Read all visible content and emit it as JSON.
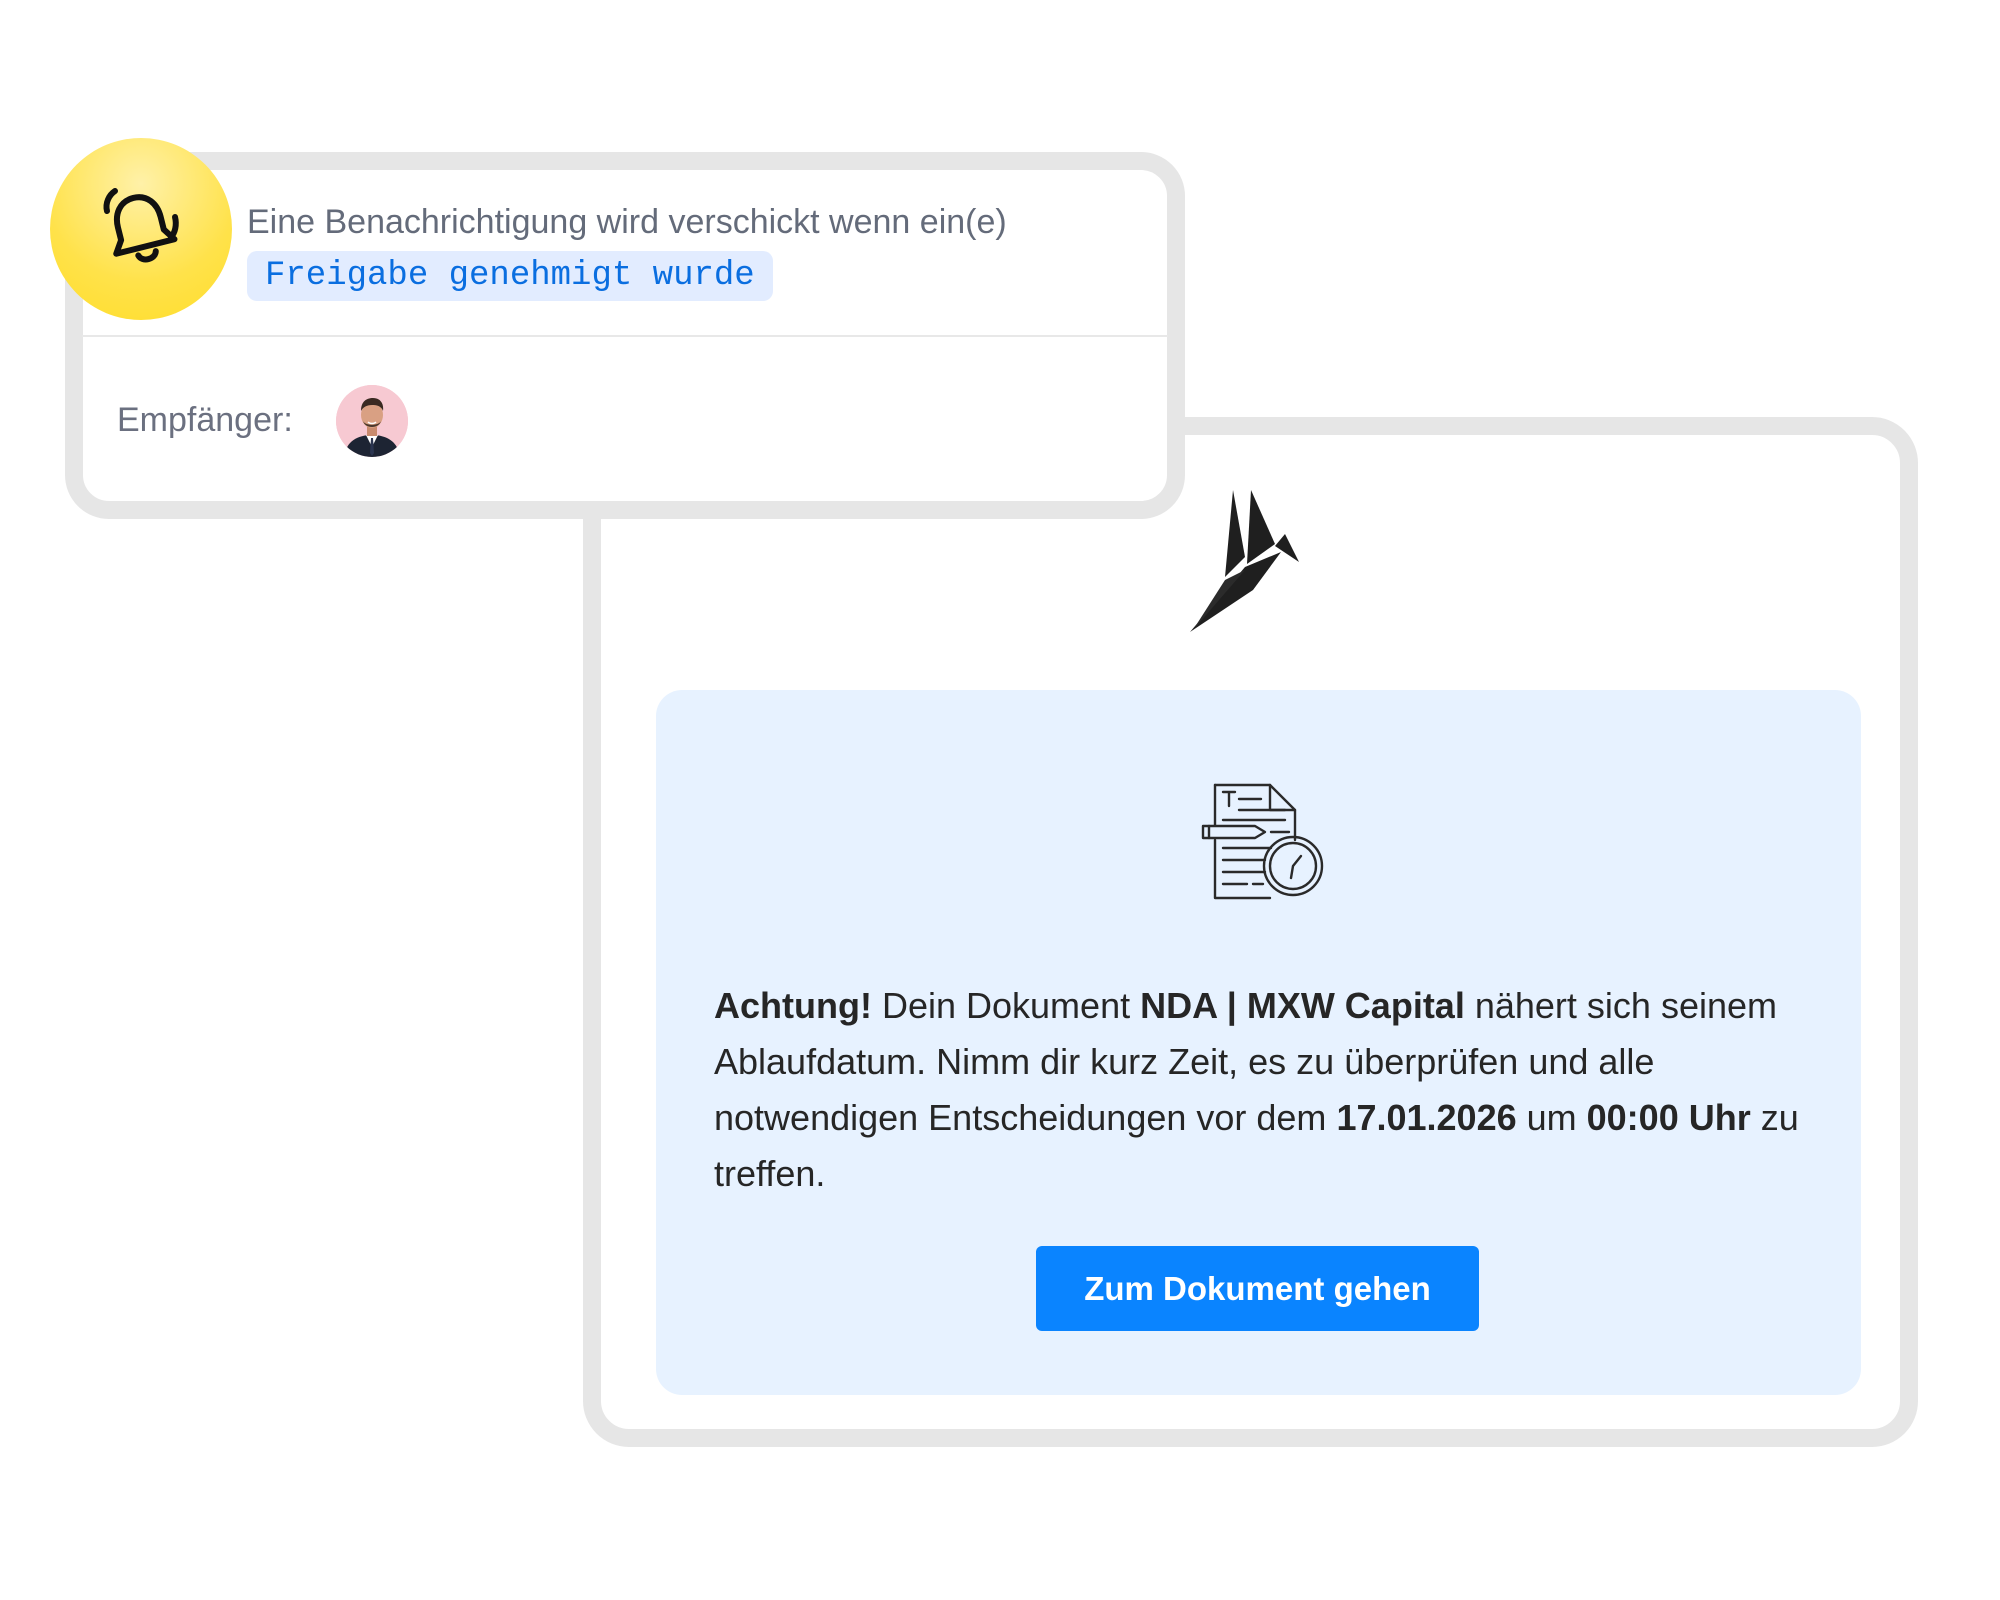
{
  "notification": {
    "intro_text": "Eine Benachrichtigung wird verschickt wenn ein(e)",
    "trigger": "Freigabe genehmigt wurde",
    "recipient_label": "Empfänger:",
    "bell_icon": "bell-icon",
    "recipient_avatar": "avatar-man-in-suit"
  },
  "email": {
    "logo_icon": "origami-bird-logo",
    "document_icon": "document-clock-icon",
    "message": {
      "warning": "Achtung!",
      "text1": " Dein Dokument ",
      "document_name": "NDA | MXW Capital",
      "text2": " nähert sich seinem Ablaufdatum. Nimm dir kurz Zeit, es zu überprüfen und alle notwendigen Entscheidungen vor dem ",
      "date": "17.01.2026",
      "text3": " um ",
      "time": "00:00 Uhr",
      "text4": " zu treffen."
    },
    "cta_label": "Zum Dokument gehen"
  },
  "colors": {
    "accent": "#0a84ff",
    "panel": "#e7f2ff",
    "chip_bg": "#e2ecff",
    "bell_bg": "#ffe24a",
    "card_border": "#e6e6e6"
  }
}
